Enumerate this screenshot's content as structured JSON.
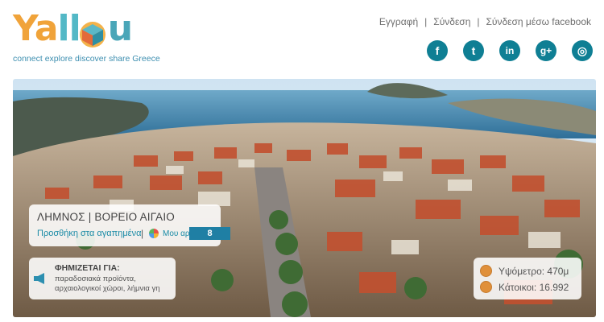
{
  "logo": {
    "wordmark_ya": "Ya",
    "wordmark_ll": "ll",
    "wordmark_u": "u",
    "tagline": "connect explore discover share Greece"
  },
  "auth_links": {
    "register": "Εγγραφή",
    "login": "Σύνδεση",
    "login_facebook": "Σύνδεση μέσω facebook",
    "separator": "|"
  },
  "social": [
    {
      "icon": "facebook-icon",
      "glyph": "f"
    },
    {
      "icon": "twitter-icon",
      "glyph": "t"
    },
    {
      "icon": "linkedin-icon",
      "glyph": "in"
    },
    {
      "icon": "google-plus-icon",
      "glyph": "g+"
    },
    {
      "icon": "instagram-icon",
      "glyph": "◎"
    }
  ],
  "destination": {
    "name": "ΛΗΜΝΟΣ | ΒΟΡΕΙΟ ΑΙΓΑΙΟ",
    "add_favorites": "Προσθήκη στα αγαπημένα",
    "separator": "|",
    "my_list": "Μου αρέσει",
    "my_list_count": "8"
  },
  "famous_for": {
    "title": "ΦΗΜΙΖΕΤΑΙ ΓΙΑ:",
    "description": "παραδοσιακά προϊόντα, αρχαιολογικοί χώροι, λήμνια γη"
  },
  "stats": {
    "altitude": "Υψόμετρο: 470μ",
    "population": "Κάτοικοι: 16.992"
  },
  "colors": {
    "brand_orange": "#f0a33a",
    "brand_teal": "#53b8c6",
    "social_teal": "#0f7f94",
    "accent_blue": "#1f7fa4"
  }
}
